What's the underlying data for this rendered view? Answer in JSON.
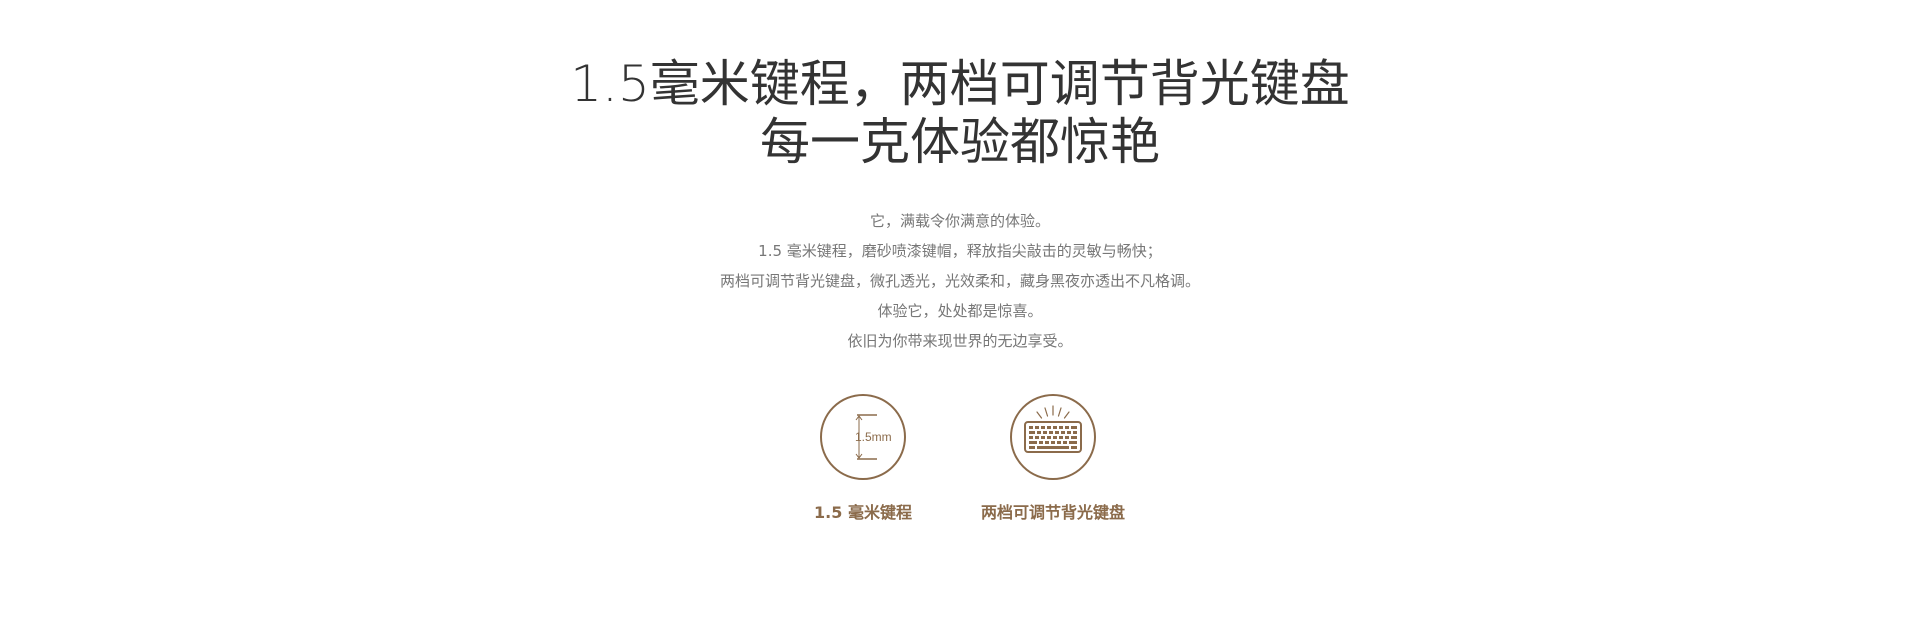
{
  "headline": {
    "line1": "1.5毫米键程，两档可调节背光键盘",
    "line2": "每一克体验都惊艳"
  },
  "description": [
    "它，满载令你满意的体验。",
    "1.5 毫米键程，磨砂喷漆键帽，释放指尖敲击的灵敏与畅快；",
    "两档可调节背光键盘，微孔透光，光效柔和，藏身黑夜亦透出不凡格调。",
    "体验它，处处都是惊喜。",
    "依旧为你带来现世界的无边享受。"
  ],
  "features": [
    {
      "icon": "key-travel-icon",
      "icon_text": "1.5mm",
      "label": "1.5 毫米键程"
    },
    {
      "icon": "backlit-keyboard-icon",
      "label": "两档可调节背光键盘"
    }
  ],
  "colors": {
    "accent": "#8b6b4b",
    "headline": "#333333",
    "body_text": "#777777",
    "background": "#ffffff"
  }
}
